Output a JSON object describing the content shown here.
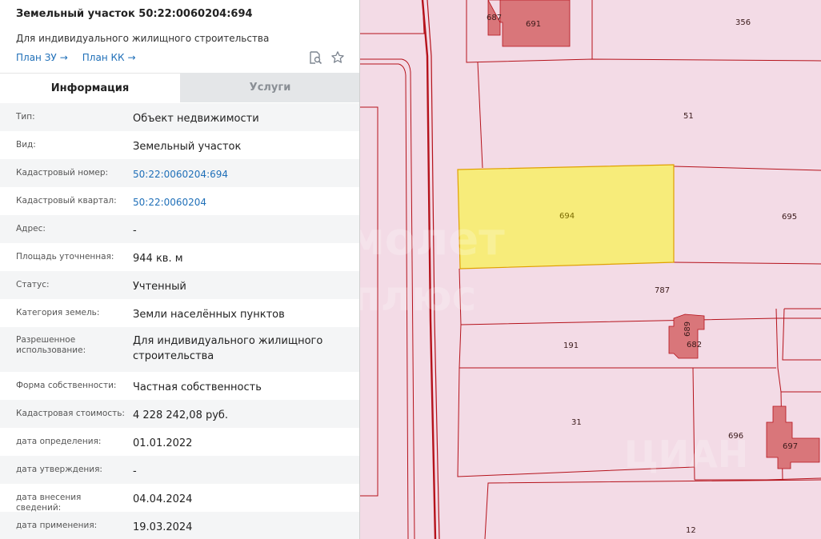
{
  "header": {
    "title": "Земельный участок 50:22:0060204:694",
    "subtitle": "Для индивидуального жилищного строительства",
    "links": [
      {
        "label": "План ЗУ",
        "arrow": "→"
      },
      {
        "label": "План КК",
        "arrow": "→"
      }
    ],
    "icons": [
      "search-document-icon",
      "star-icon"
    ]
  },
  "tabs": [
    {
      "label": "Информация",
      "active": true
    },
    {
      "label": "Услуги",
      "active": false
    }
  ],
  "info_rows": [
    {
      "label": "Тип:",
      "value": "Объект недвижимости",
      "is_link": false
    },
    {
      "label": "Вид:",
      "value": "Земельный участок",
      "is_link": false
    },
    {
      "label": "Кадастровый номер:",
      "value": "50:22:0060204:694",
      "is_link": true
    },
    {
      "label": "Кадастровый квартал:",
      "value": "50:22:0060204",
      "is_link": true
    },
    {
      "label": "Адрес:",
      "value": "-",
      "is_link": false
    },
    {
      "label": "Площадь уточненная:",
      "value": "944 кв. м",
      "is_link": false
    },
    {
      "label": "Статус:",
      "value": "Учтенный",
      "is_link": false
    },
    {
      "label": "Категория земель:",
      "value": "Земли населённых пунктов",
      "is_link": false
    },
    {
      "label": "Разрешенное использование:",
      "value": "Для индивидуального жилищного строительства",
      "is_link": false
    },
    {
      "label": "Форма собственности:",
      "value": "Частная собственность",
      "is_link": false
    },
    {
      "label": "Кадастровая стоимость:",
      "value": "4 228 242,08 руб.",
      "is_link": false
    },
    {
      "label": "дата определения:",
      "value": "01.01.2022",
      "is_link": false
    },
    {
      "label": "дата утверждения:",
      "value": "-",
      "is_link": false
    },
    {
      "label": "дата внесения сведений:",
      "value": "04.04.2024",
      "is_link": false
    },
    {
      "label": "дата применения:",
      "value": "19.03.2024",
      "is_link": false
    }
  ],
  "map": {
    "colors": {
      "background": "#f3dbe6",
      "boundary": "#b5121b",
      "selected_fill": "#f7ec7a",
      "selected_stroke": "#e0a000",
      "building_fill": "#d9767a"
    },
    "plot_labels": {
      "p687": "687",
      "p691": "691",
      "p356": "356",
      "p51": "51",
      "p694": "694",
      "p695": "695",
      "p787": "787",
      "p191": "191",
      "p689": "689",
      "p682": "682",
      "p31": "31",
      "p696": "696",
      "p697": "697",
      "p12": "12"
    },
    "watermarks": {
      "brand1": "самолет",
      "brand1_sub": "плюс",
      "brand2": "ЦИАН"
    }
  }
}
